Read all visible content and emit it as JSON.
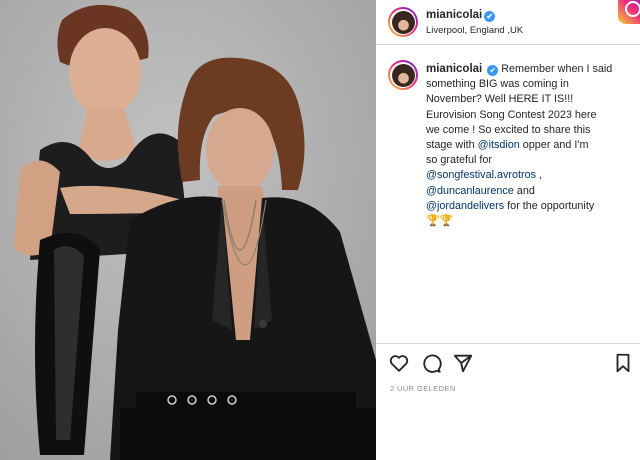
{
  "post": {
    "username": "mianicolai",
    "location": "Liverpool, England ,UK",
    "verified_mark": "✔",
    "caption": {
      "line1": "Remember when I said",
      "line2": "something BIG was coming in",
      "line3": "November? Well HERE IT IS!!!",
      "line4": "Eurovision Song Contest 2023 here",
      "line5": "we come ! So excited to share this",
      "line6_prefix": "stage with ",
      "mention_itsdion": "@itsdion",
      "line6_suffix": " opper and I'm",
      "line7": "so grateful for",
      "mention_songfestival": "@songfestival.avrotros",
      "line8_suffix": " ,",
      "mention_duncan": "@duncanlaurence",
      "line9_suffix": " and",
      "mention_jordan": "@jordandelivers",
      "line10_suffix": " for the opportunity",
      "trophies": "🏆🏆"
    },
    "timestamp": "2 UUR GELEDEN"
  },
  "icons": {
    "avatar": "profile-avatar",
    "like": "heart-icon",
    "comment": "comment-bubble-icon",
    "share": "paper-plane-icon",
    "save": "bookmark-icon",
    "app": "instagram-logo"
  },
  "colors": {
    "mention": "#00376b",
    "verified": "#3897f0",
    "text": "#262626",
    "muted": "#8e8e8e",
    "divider": "#dbdbdb"
  }
}
